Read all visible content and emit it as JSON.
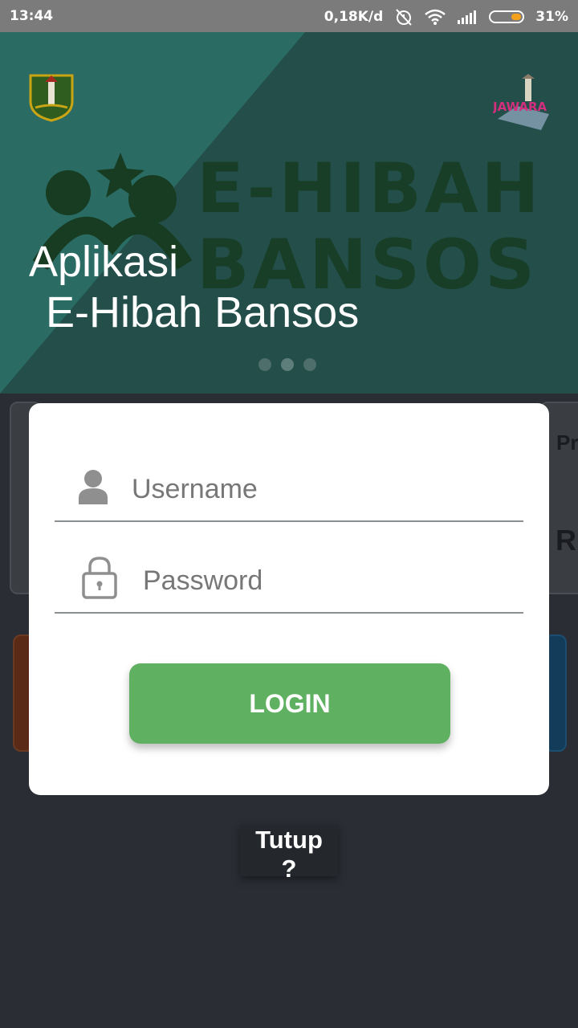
{
  "status_bar": {
    "time": "13:44",
    "network_speed": "0,18K/d",
    "battery": "31%",
    "icons": [
      "alarm-off-icon",
      "wifi-icon",
      "signal-icon",
      "battery-icon"
    ]
  },
  "banner": {
    "title_line1": "Aplikasi",
    "title_line2": "E-Hibah Bansos",
    "watermark_line1": "E-HIBAH",
    "watermark_line2": "BANSOS",
    "right_logo_text": "JAWARA",
    "slide_count": 3,
    "active_slide": 2
  },
  "background": {
    "peek_text_1": "Pr",
    "peek_text_2": "R"
  },
  "login_dialog": {
    "username_placeholder": "Username",
    "password_placeholder": "Password",
    "login_label": "LOGIN"
  },
  "close_button_label": "Tutup ?",
  "colors": {
    "login_button": "#5fb061",
    "banner_bg": "#234e4a",
    "status_bar": "#7b7b7b",
    "battery_fill": "#f4a11d"
  }
}
